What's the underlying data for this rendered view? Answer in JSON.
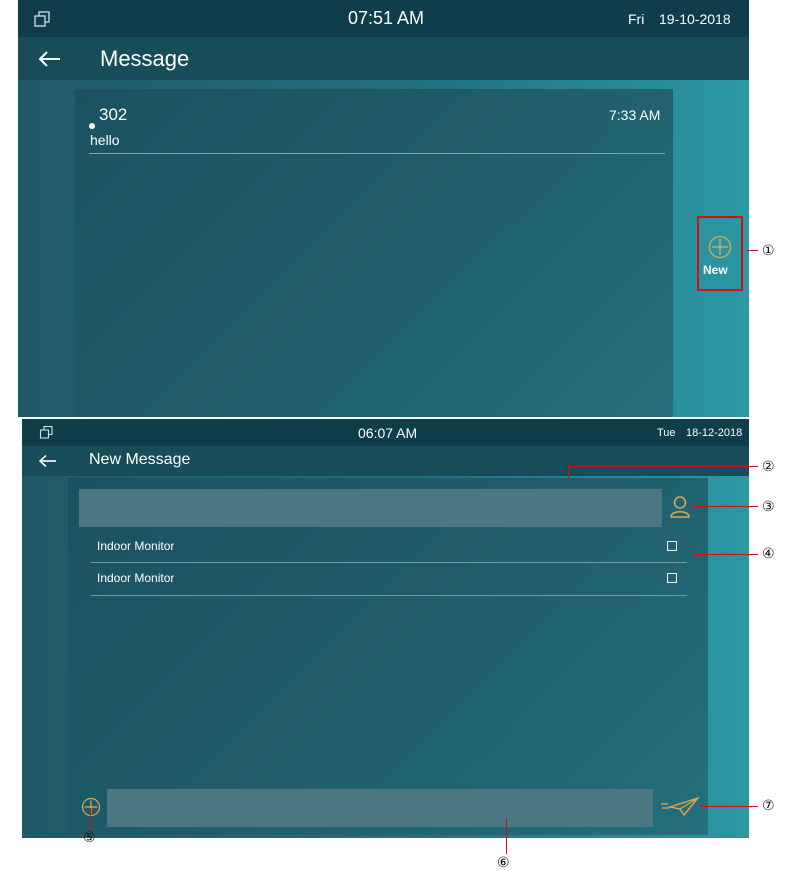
{
  "screen1": {
    "status": {
      "time": "07:51 AM",
      "day": "Fri",
      "date": "19-10-2018"
    },
    "title": "Message",
    "messages": [
      {
        "sender": "302",
        "body": "hello",
        "time": "7:33 AM"
      }
    ],
    "new_button_label": "New"
  },
  "screen2": {
    "status": {
      "time": "06:07 AM",
      "day": "Tue",
      "date": "18-12-2018"
    },
    "title": "New Message",
    "contacts": [
      {
        "name": "Indoor Monitor"
      },
      {
        "name": "Indoor Monitor"
      }
    ]
  },
  "annotations": [
    "①",
    "②",
    "③",
    "④",
    "⑤",
    "⑥",
    "⑦"
  ],
  "colors": {
    "accent": "#e0a850",
    "highlight_box": "#d01010"
  }
}
